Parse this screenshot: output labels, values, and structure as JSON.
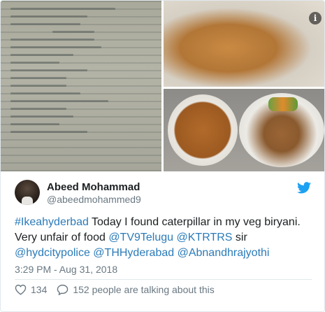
{
  "media": {
    "images": [
      "receipt-photo",
      "biryani-closeup-photo",
      "biryani-plates-photo"
    ],
    "info_icon": "info-icon"
  },
  "author": {
    "name": "Abeed Mohammad",
    "handle": "@abeedmohammed9",
    "avatar": "avatar"
  },
  "tweet": {
    "hashtag": "#Ikeahyderbad",
    "text_1": " Today I found caterpillar in my veg biryani. Very unfair of food ",
    "mention_1": "@TV9Telugu",
    "sep_1": " ",
    "mention_2": "@KTRTRS",
    "text_2": " sir ",
    "mention_3": "@hydcitypolice",
    "sep_2": " ",
    "mention_4": "@THHyderabad",
    "sep_3": " ",
    "mention_5": "@Abnandhrajyothi",
    "timestamp": "3:29 PM - Aug 31, 2018"
  },
  "actions": {
    "like_count": "134",
    "reply_text": "152 people are talking about this"
  },
  "colors": {
    "link": "#2b7bb9",
    "secondary_text": "#697882",
    "twitter_blue": "#1da1f2",
    "border": "#e1e8ed"
  },
  "icons": {
    "brand": "twitter-bird-icon",
    "like": "heart-icon",
    "reply": "speech-bubble-icon"
  }
}
